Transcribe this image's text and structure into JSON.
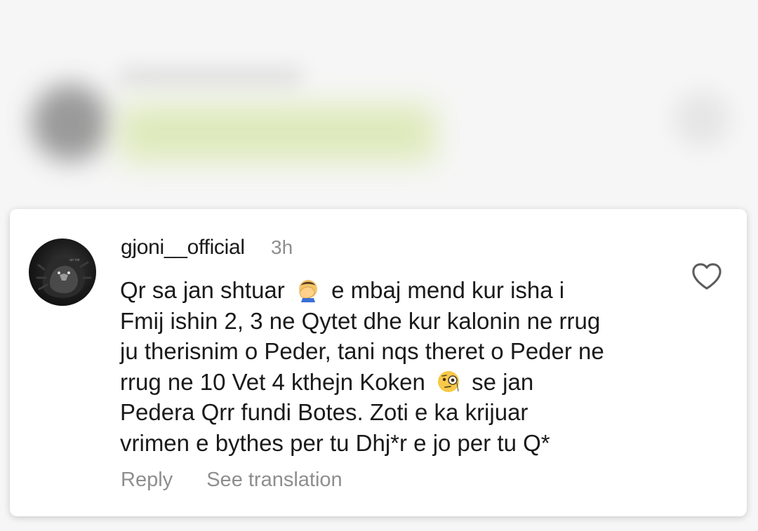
{
  "comment": {
    "username": "gjoni__official",
    "timestamp": "3h",
    "avatar_icon": "lion-avatar-icon",
    "like_icon": "heart-outline-icon",
    "lines": [
      {
        "before": "Qr sa jan shtuar",
        "emoji": "face-palm-emoji",
        "after": "e mbaj mend kur isha i"
      },
      {
        "text": "Fmij ishin 2, 3 ne Qytet dhe kur kalonin ne rrug"
      },
      {
        "text": "ju therisnim o Peder, tani nqs theret o Peder ne"
      },
      {
        "before": "rrug ne 10 Vet 4 kthejn Koken",
        "emoji": "monocle-face-emoji",
        "after": "se jan"
      },
      {
        "text": "Pedera Qrr fundi Botes. Zoti e ka krijuar"
      },
      {
        "text": "vrimen e bythes per tu Dhj*r e jo per tu Q*"
      }
    ]
  },
  "actions": {
    "reply_label": "Reply",
    "translate_label": "See translation"
  },
  "colors": {
    "text": "#1a1a1a",
    "muted": "#8e8e8e",
    "card_bg": "#ffffff",
    "background": "#f6f6f6"
  }
}
